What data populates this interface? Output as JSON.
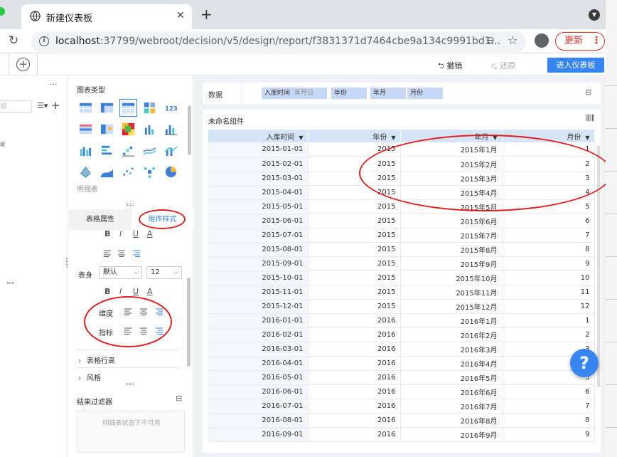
{
  "browser": {
    "tab_title": "新建仪表板",
    "tab_close": "✕",
    "new_tab": "+",
    "url_host": "localhost",
    "url_path": ":37799/webroot/decision/v5/design/report/f3831371d7464cbe9a134c9991bd1...",
    "update_label": "更新",
    "menu_dots": "⋮"
  },
  "app": {
    "undo": "撤销",
    "redo": "还原",
    "enter_dashboard": "进入仪表板",
    "left_more": "···",
    "left_search_placeholder": "段",
    "left_item": "间"
  },
  "chart_panel": {
    "title": "图表类型",
    "detail_label": "明细表",
    "tab_table_attr": "表格属性",
    "tab_component_style": "组件样式",
    "body_label": "表身",
    "body_font": "默认",
    "body_size": "12",
    "dimension_label": "维度",
    "indicator_label": "指标",
    "row_height": "表格行高",
    "style": "风格",
    "result_filter": "结果过滤器",
    "filter_disabled": "明细表状态下不可用"
  },
  "data_bar": {
    "label": "数据",
    "pills": [
      {
        "label": "入库时间",
        "sub": "年月日"
      },
      {
        "label": "年份",
        "sub": ""
      },
      {
        "label": "年月",
        "sub": ""
      },
      {
        "label": "月份",
        "sub": ""
      }
    ]
  },
  "widget": {
    "title": "未命名组件",
    "columns": [
      "入库时间",
      "年份",
      "年月",
      "月份"
    ],
    "rows": [
      [
        "2015-01-01",
        "2015",
        "2015年1月",
        "1"
      ],
      [
        "2015-02-01",
        "2015",
        "2015年2月",
        "2"
      ],
      [
        "2015-03-01",
        "2015",
        "2015年3月",
        "3"
      ],
      [
        "2015-04-01",
        "2015",
        "2015年4月",
        "4"
      ],
      [
        "2015-05-01",
        "2015",
        "2015年5月",
        "5"
      ],
      [
        "2015-06-01",
        "2015",
        "2015年6月",
        "6"
      ],
      [
        "2015-07-01",
        "2015",
        "2015年7月",
        "7"
      ],
      [
        "2015-08-01",
        "2015",
        "2015年8月",
        "8"
      ],
      [
        "2015-09-01",
        "2015",
        "2015年9月",
        "9"
      ],
      [
        "2015-10-01",
        "2015",
        "2015年10月",
        "10"
      ],
      [
        "2015-11-01",
        "2015",
        "2015年11月",
        "11"
      ],
      [
        "2015-12-01",
        "2015",
        "2015年12月",
        "12"
      ],
      [
        "2016-01-01",
        "2016",
        "2016年1月",
        "1"
      ],
      [
        "2016-02-01",
        "2016",
        "2016年2月",
        "2"
      ],
      [
        "2016-03-01",
        "2016",
        "2016年3月",
        "3"
      ],
      [
        "2016-04-01",
        "2016",
        "2016年4月",
        "4"
      ],
      [
        "2016-05-01",
        "2016",
        "2016年5月",
        "5"
      ],
      [
        "2016-06-01",
        "2016",
        "2016年6月",
        "6"
      ],
      [
        "2016-07-01",
        "2016",
        "2016年7月",
        "7"
      ],
      [
        "2016-08-01",
        "2016",
        "2016年8月",
        "8"
      ],
      [
        "2016-09-01",
        "2016",
        "2016年9月",
        "9"
      ]
    ]
  },
  "help_label": "?",
  "colors": {
    "accent": "#3685f2",
    "annotation": "#e02020",
    "header": "#d6e4f7"
  }
}
